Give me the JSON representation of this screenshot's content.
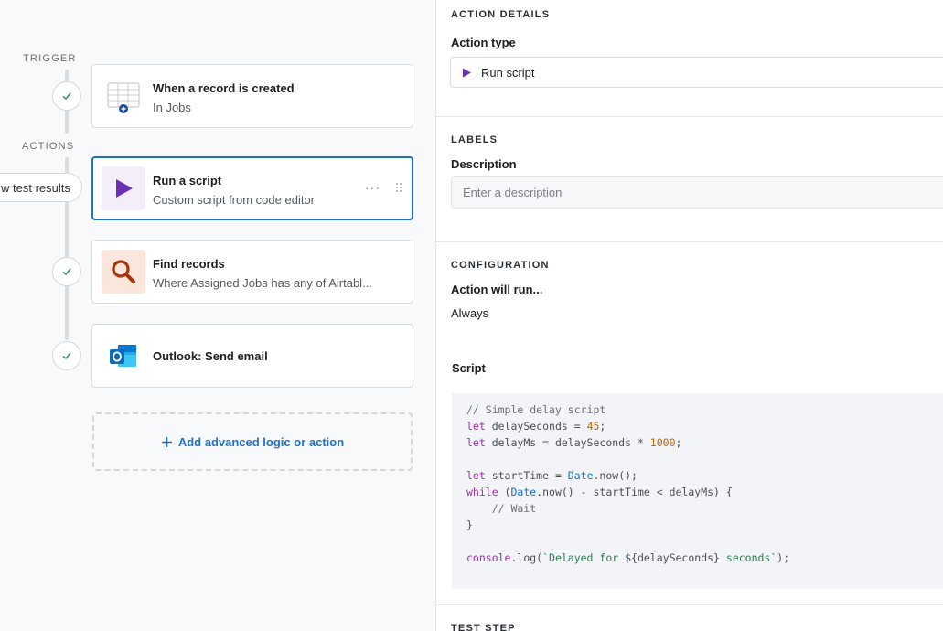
{
  "flow": {
    "trigger_label": "TRIGGER",
    "actions_label": "ACTIONS",
    "trigger_card": {
      "title": "When a record is created",
      "subtitle": "In Jobs"
    },
    "steps": [
      {
        "title": "Run a script",
        "subtitle": "Custom script from code editor",
        "selected": true
      },
      {
        "title": "Find records",
        "subtitle": "Where Assigned Jobs has any of Airtabl..."
      },
      {
        "title": "Outlook: Send email",
        "subtitle": ""
      }
    ],
    "test_results_label": "w test results",
    "add_label": "Add advanced logic or action"
  },
  "details": {
    "section_action": "ACTION DETAILS",
    "action_type_label": "Action type",
    "action_type_value": "Run script",
    "section_labels": "LABELS",
    "description_label": "Description",
    "description_placeholder": "Enter a description",
    "section_config": "CONFIGURATION",
    "action_will_run_label": "Action will run...",
    "action_will_run_value": "Always",
    "script_label": "Script",
    "section_test": "TEST STEP"
  },
  "script": {
    "line1": "// Simple delay script",
    "line2_kw": "let",
    "line2_rest": " delaySeconds = ",
    "line2_num": "45",
    "line3_kw": "let",
    "line3_rest": " delayMs = delaySeconds * ",
    "line3_num": "1000",
    "line5_kw": "let",
    "line5_rest": " startTime = ",
    "line5_cls": "Date",
    "line5_tail": ".now();",
    "line6_kw": "while",
    "line6_a": " (",
    "line6_cls": "Date",
    "line6_b": ".now() - startTime < delayMs) {",
    "line7": "    // Wait",
    "line8": "}",
    "line10_kw": "console",
    "line10_a": ".log(",
    "line10_str1": "`Delayed for ",
    "line10_tpl": "${delaySeconds}",
    "line10_str2": " seconds`",
    "line10_end": ");"
  },
  "colors": {
    "accent": "#1f6fc5",
    "script_icon": "#6b2fb6",
    "find_icon": "#a8330c",
    "outlook": "#0f6cbd"
  }
}
